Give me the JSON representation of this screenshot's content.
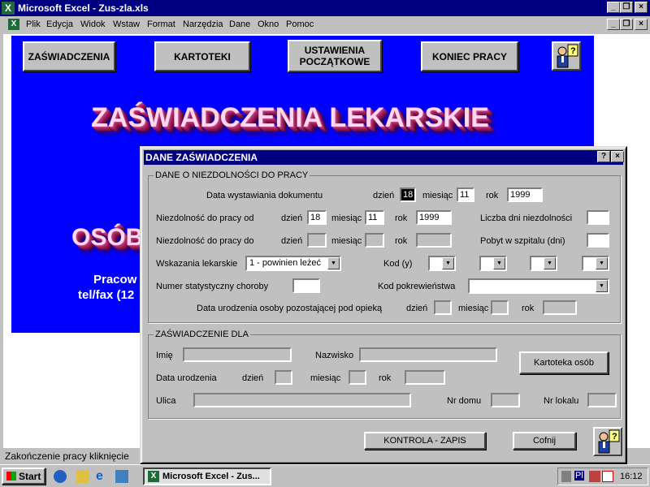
{
  "window": {
    "title": "Microsoft Excel - Zus-zla.xls",
    "app_icon": "excel-icon"
  },
  "menu": [
    "Plik",
    "Edycja",
    "Widok",
    "Wstaw",
    "Format",
    "Narzędzia",
    "Dane",
    "Okno",
    "Pomoc"
  ],
  "sheet": {
    "nav_buttons": {
      "zaswiadczenia": "ZAŚWIADCZENIA",
      "kartoteki": "KARTOTEKI",
      "ustawienia": "USTAWIENIA POCZĄTKOWE",
      "koniec": "KONIEC PRACY"
    },
    "headline": "ZAŚWIADCZENIA LEKARSKIE",
    "partial_line1": "OSÓB",
    "partial_line2": "Pracow",
    "partial_line3": "tel/fax (12"
  },
  "status": {
    "text": "Zakończenie pracy kliknięcie"
  },
  "dialog": {
    "title": "DANE ZAŚWIADCZENIA",
    "help_btn": "?",
    "close_btn": "×",
    "group1": {
      "label": "DANE O NIEZDOLNOŚCI DO PRACY",
      "data_wyst_label": "Data wystawiania dokumentu",
      "dzien": "dzień",
      "miesiac": "miesiąc",
      "rok": "rok",
      "wyst_dzien": "18",
      "wyst_miesiac": "11",
      "wyst_rok": "1999",
      "niezd_od_label": "Niezdolność do pracy od",
      "od_dzien": "18",
      "od_miesiac": "11",
      "od_rok": "1999",
      "liczba_dni_label": "Liczba dni niezdolności",
      "niezd_do_label": "Niezdolność do pracy do",
      "pobyt_label": "Pobyt w szpitalu (dni)",
      "wskazania_label": "Wskazania lekarskie",
      "wskazania_value": "1 - powinien leżeć",
      "kod_label": "Kod (y)",
      "numer_stat_label": "Numer statystyczny choroby",
      "kod_pokr_label": "Kod pokrewieństwa",
      "data_ur_opieka_label": "Data urodzenia osoby pozostającej pod opieką"
    },
    "group2": {
      "label": "ZAŚWIADCZENIE DLA",
      "imie_label": "Imię",
      "nazwisko_label": "Nazwisko",
      "kartoteka_btn": "Kartoteka osób",
      "data_ur_label": "Data urodzenia",
      "ulica_label": "Ulica",
      "nr_domu_label": "Nr domu",
      "nr_lokalu_label": "Nr lokalu"
    },
    "kontrola_btn": "KONTROLA - ZAPIS",
    "cofnij_btn": "Cofnij"
  },
  "taskbar": {
    "start": "Start",
    "task": "Microsoft Excel - Zus...",
    "clock": "16:12",
    "tray_lang": "Pl"
  }
}
